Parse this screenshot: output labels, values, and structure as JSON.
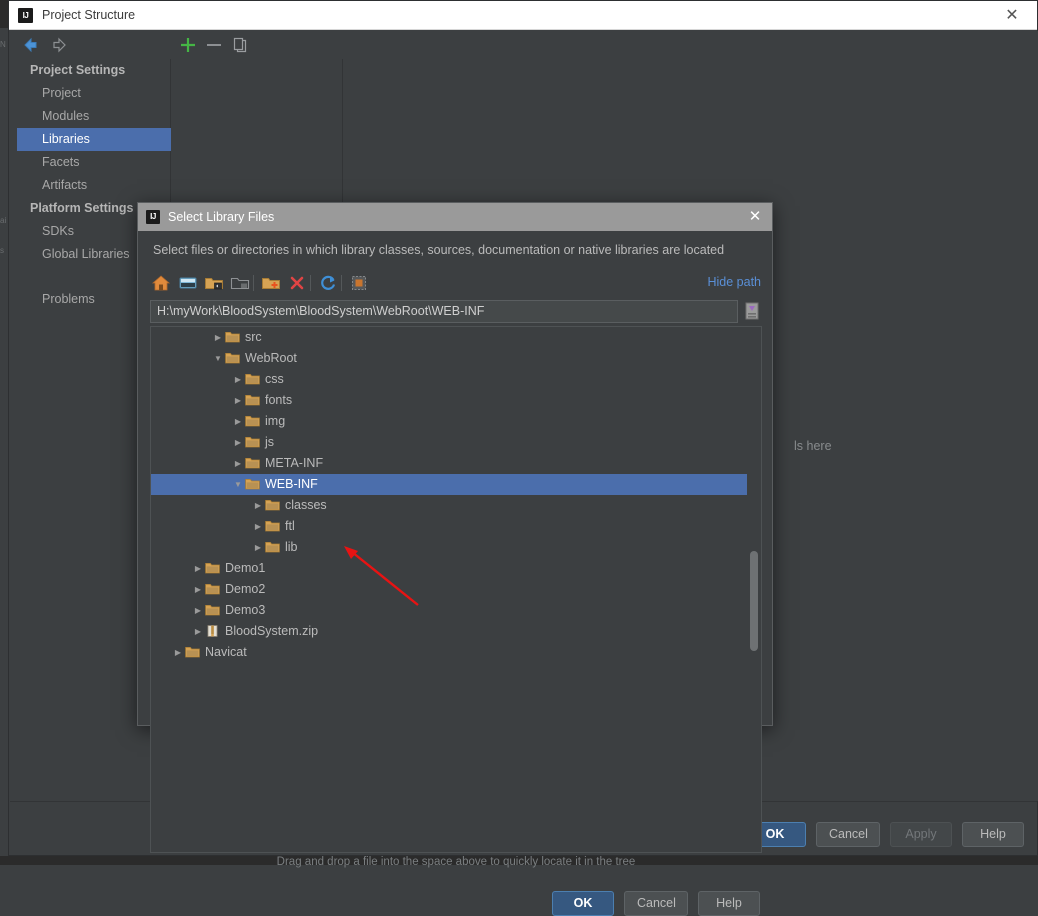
{
  "main_window": {
    "title": "Project Structure",
    "close_icon": "close-icon",
    "nav": {
      "back_icon": "arrow-left-icon",
      "forward_icon": "arrow-right-icon"
    },
    "list_toolbar": [
      {
        "name": "add-button",
        "icon": "plus-icon",
        "label": "+"
      },
      {
        "name": "remove-button",
        "icon": "minus-icon",
        "label": "–"
      },
      {
        "name": "copy-button",
        "icon": "copy-icon",
        "label": ""
      }
    ],
    "sidebar": {
      "groups": [
        {
          "label": "Project Settings",
          "items": [
            {
              "label": "Project",
              "selected": false
            },
            {
              "label": "Modules",
              "selected": false
            },
            {
              "label": "Libraries",
              "selected": true
            },
            {
              "label": "Facets",
              "selected": false
            },
            {
              "label": "Artifacts",
              "selected": false
            }
          ]
        },
        {
          "label": "Platform Settings",
          "items": [
            {
              "label": "SDKs",
              "selected": false
            },
            {
              "label": "Global Libraries",
              "selected": false
            }
          ]
        }
      ],
      "extra_items": [
        {
          "label": "Problems",
          "selected": false
        }
      ]
    },
    "detail_hint": "ls here",
    "buttons": {
      "ok": "OK",
      "cancel": "Cancel",
      "apply": "Apply",
      "help": "Help"
    }
  },
  "dialog": {
    "title": "Select Library Files",
    "close_icon": "close-icon",
    "description": "Select files or directories in which library classes, sources, documentation or native libraries are located",
    "toolbar": [
      {
        "name": "home-icon",
        "title": "Home"
      },
      {
        "name": "desktop-icon",
        "title": "Desktop"
      },
      {
        "name": "project-dir-icon",
        "title": "Project Directory"
      },
      {
        "name": "module-dir-icon",
        "title": "Module Directory"
      },
      {
        "name": "new-folder-icon",
        "title": "New Folder"
      },
      {
        "name": "delete-icon",
        "title": "Delete"
      },
      {
        "name": "refresh-icon",
        "title": "Refresh"
      },
      {
        "name": "show-hidden-icon",
        "title": "Show Hidden Files"
      }
    ],
    "hide_path_label": "Hide path",
    "path_value": "H:\\myWork\\BloodSystem\\BloodSystem\\WebRoot\\WEB-INF",
    "path_placeholder": "",
    "path_history_icon": "path-history-icon",
    "tree": [
      {
        "label": "src",
        "indent": 3,
        "twist": "collapsed",
        "icon": "folder-icon",
        "selected": false
      },
      {
        "label": "WebRoot",
        "indent": 3,
        "twist": "expanded",
        "icon": "folder-icon",
        "selected": false
      },
      {
        "label": "css",
        "indent": 4,
        "twist": "collapsed",
        "icon": "folder-icon",
        "selected": false
      },
      {
        "label": "fonts",
        "indent": 4,
        "twist": "collapsed",
        "icon": "folder-icon",
        "selected": false
      },
      {
        "label": "img",
        "indent": 4,
        "twist": "collapsed",
        "icon": "folder-icon",
        "selected": false
      },
      {
        "label": "js",
        "indent": 4,
        "twist": "collapsed",
        "icon": "folder-icon",
        "selected": false
      },
      {
        "label": "META-INF",
        "indent": 4,
        "twist": "collapsed",
        "icon": "folder-icon",
        "selected": false
      },
      {
        "label": "WEB-INF",
        "indent": 4,
        "twist": "expanded",
        "icon": "folder-icon",
        "selected": true
      },
      {
        "label": "classes",
        "indent": 5,
        "twist": "collapsed",
        "icon": "folder-icon",
        "selected": false
      },
      {
        "label": "ftl",
        "indent": 5,
        "twist": "collapsed",
        "icon": "folder-icon",
        "selected": false
      },
      {
        "label": "lib",
        "indent": 5,
        "twist": "collapsed",
        "icon": "folder-icon",
        "selected": false
      },
      {
        "label": "Demo1",
        "indent": 2,
        "twist": "collapsed",
        "icon": "folder-icon",
        "selected": false
      },
      {
        "label": "Demo2",
        "indent": 2,
        "twist": "collapsed",
        "icon": "folder-icon",
        "selected": false
      },
      {
        "label": "Demo3",
        "indent": 2,
        "twist": "collapsed",
        "icon": "folder-icon",
        "selected": false
      },
      {
        "label": "BloodSystem.zip",
        "indent": 2,
        "twist": "collapsed",
        "icon": "zip-icon",
        "selected": false
      },
      {
        "label": "Navicat",
        "indent": 1,
        "twist": "collapsed",
        "icon": "folder-icon",
        "selected": false
      }
    ],
    "drag_hint": "Drag and drop a file into the space above to quickly locate it in the tree",
    "buttons": {
      "ok": "OK",
      "cancel": "Cancel",
      "help": "Help"
    }
  },
  "annotation": {
    "arrow_color": "#e81313",
    "name": "red-arrow-annotation"
  },
  "colors": {
    "window_bg": "#3c3f41",
    "selection_blue": "#4b6eac",
    "link_blue": "#5a8fd6",
    "primary_button": "#365880",
    "folder_gold": "#d6a354",
    "title_bar_light": "#ffffff",
    "dialog_title_bar": "#9a9a9a"
  },
  "behind_sliver_lines": [
    "N",
    "ai",
    "s"
  ]
}
